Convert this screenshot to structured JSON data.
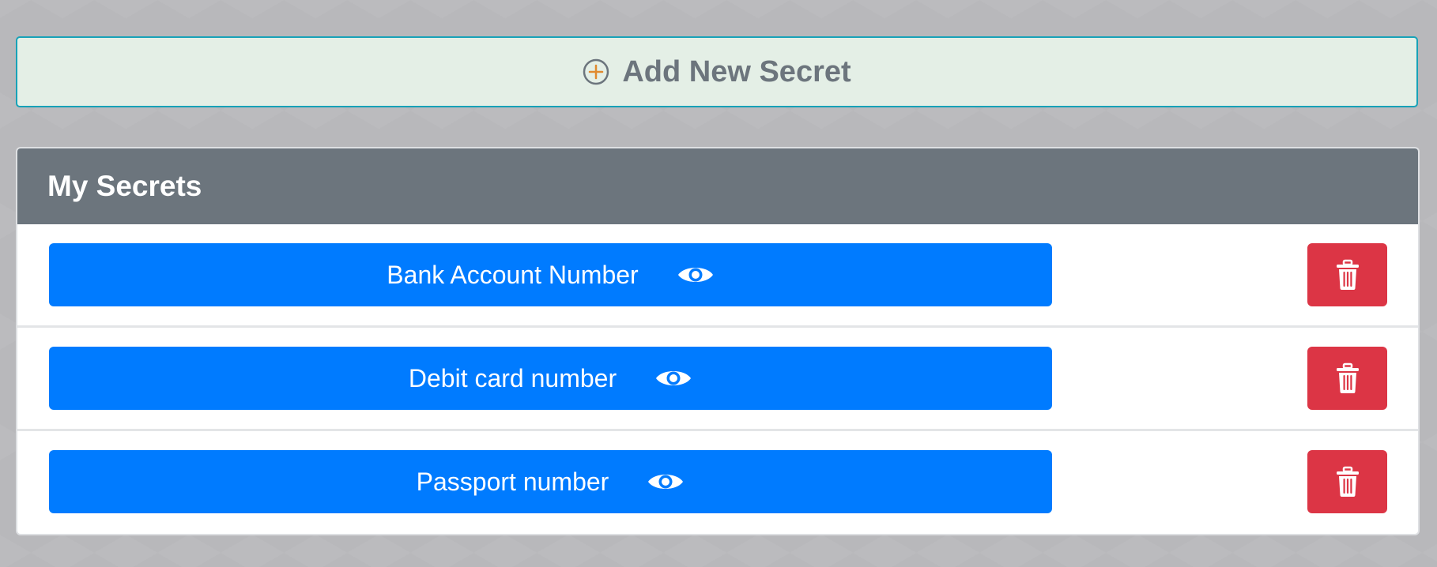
{
  "add_button": {
    "label": "Add New Secret",
    "icon": "plus-circle-icon"
  },
  "secrets_card": {
    "title": "My Secrets",
    "items": [
      {
        "label": "Bank Account Number",
        "reveal_icon": "eye-icon",
        "delete_icon": "trash-icon"
      },
      {
        "label": "Debit card number",
        "reveal_icon": "eye-icon",
        "delete_icon": "trash-icon"
      },
      {
        "label": "Passport number",
        "reveal_icon": "eye-icon",
        "delete_icon": "trash-icon"
      }
    ]
  },
  "colors": {
    "page_background": "#b8b8bb",
    "add_button_background": "#e4efe6",
    "add_button_border": "#17a2b8",
    "add_button_text": "#6c757d",
    "plus_icon_accent": "#e08a2e",
    "header_background": "#6c757d",
    "primary_button": "#007bff",
    "danger_button": "#dc3545"
  }
}
